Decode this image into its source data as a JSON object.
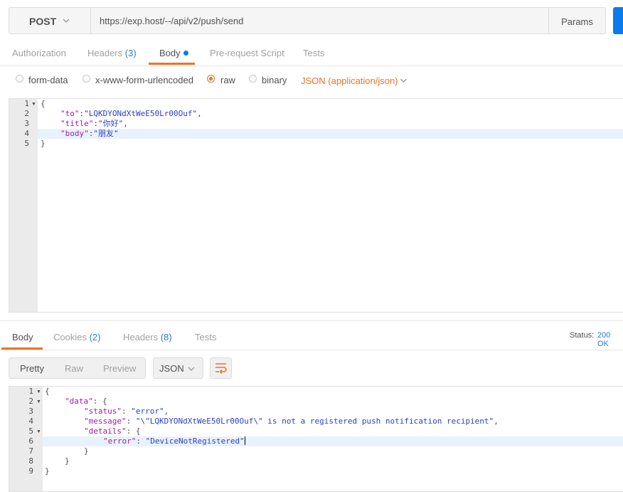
{
  "request": {
    "method": "POST",
    "url": "https://exp.host/--/api/v2/push/send",
    "params_label": "Params"
  },
  "request_tabs": [
    {
      "label": "Authorization"
    },
    {
      "label": "Headers",
      "count": "(3)"
    },
    {
      "label": "Body"
    },
    {
      "label": "Pre-request Script"
    },
    {
      "label": "Tests"
    }
  ],
  "body_modes": {
    "options": [
      "form-data",
      "x-www-form-urlencoded",
      "raw",
      "binary"
    ],
    "selected": "raw",
    "content_type": "JSON (application/json)"
  },
  "request_body": {
    "line_numbers": [
      "1",
      "2",
      "3",
      "4",
      "5"
    ],
    "open_brace": "{",
    "close_brace": "}",
    "fields": [
      {
        "key": "\"to\"",
        "value": "\"LQKDYONdXtWeE50Lr00Ouf\"",
        "sep": ":",
        "trail": ","
      },
      {
        "key": "\"title\"",
        "value": "\"你好\"",
        "sep": ":",
        "trail": ","
      },
      {
        "key": "\"body\"",
        "value": "\"朋友\"",
        "sep": ":",
        "trail": ""
      }
    ]
  },
  "response_tabs": [
    {
      "label": "Body"
    },
    {
      "label": "Cookies",
      "count": "(2)"
    },
    {
      "label": "Headers",
      "count": "(8)"
    },
    {
      "label": "Tests"
    }
  ],
  "status": {
    "label": "Status:",
    "value": "200 OK"
  },
  "response_format": {
    "options": [
      "Pretty",
      "Raw",
      "Preview"
    ],
    "selected": "Pretty",
    "language": "JSON"
  },
  "response_body": {
    "line_numbers": [
      "1",
      "2",
      "3",
      "4",
      "5",
      "6",
      "7",
      "8",
      "9"
    ],
    "l1": "{",
    "data_key": "\"data\"",
    "l2_rest": ": {",
    "status_key": "\"status\"",
    "status_value": "\"error\"",
    "message_key": "\"message\"",
    "message_value": "\"\\\"LQKDYONdXtWeE50Lr00Ouf\\\" is not a registered push notification recipient\"",
    "details_key": "\"details\"",
    "l5_rest": ": {",
    "error_key": "\"error\"",
    "error_value": "\"DeviceNotRegistered\"",
    "l7": "}",
    "l8": "}",
    "l9": "}"
  },
  "colors": {
    "accent": "#f47023",
    "send": "#097bed",
    "key": "#a11cab",
    "string": "#2b3fc9",
    "link": "#2b7bd3"
  }
}
